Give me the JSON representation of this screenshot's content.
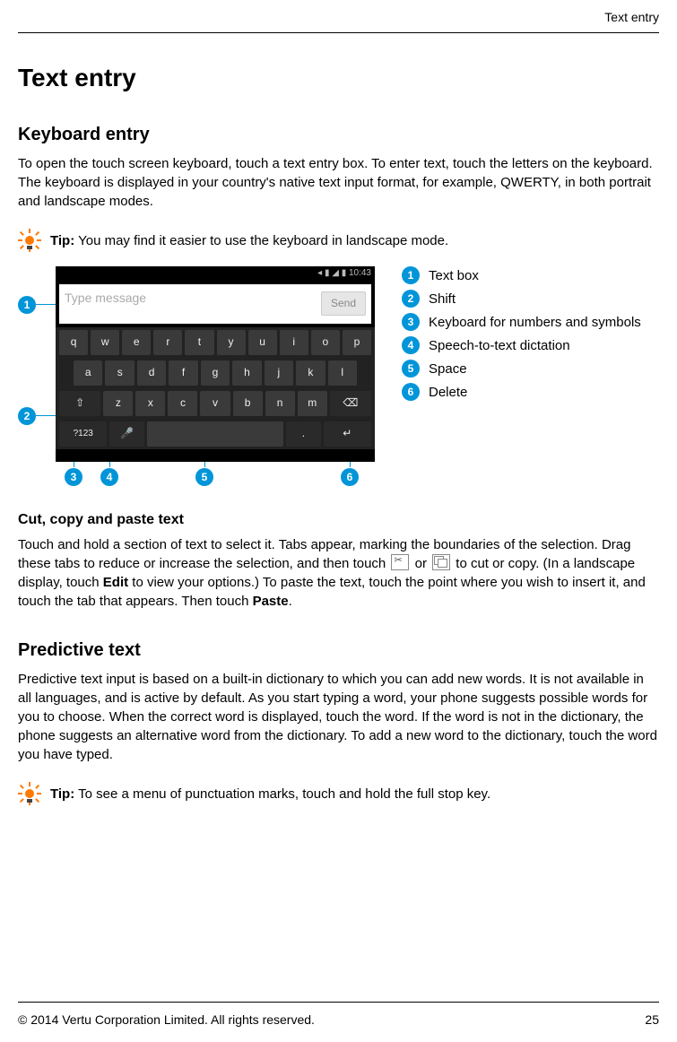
{
  "header": {
    "running_title": "Text entry"
  },
  "title": "Text entry",
  "section1": {
    "heading": "Keyboard entry",
    "body": "To open the touch screen keyboard, touch a text entry box. To enter text, touch the letters on the keyboard. The keyboard is displayed in your country's native text input format, for example, QWERTY, in both portrait and landscape modes."
  },
  "tip1": {
    "label": "Tip:",
    "text": " You may find it easier to use the keyboard in landscape mode."
  },
  "phone": {
    "status_time": "◂ ▮ ◢ ▮ 10:43",
    "placeholder": "Type message",
    "send": "Send",
    "row1": [
      "q",
      "w",
      "e",
      "r",
      "t",
      "y",
      "u",
      "i",
      "o",
      "p"
    ],
    "row2": [
      "a",
      "s",
      "d",
      "f",
      "g",
      "h",
      "j",
      "k",
      "l"
    ],
    "row3_shift": "⇧",
    "row3": [
      "z",
      "x",
      "c",
      "v",
      "b",
      "n",
      "m"
    ],
    "row3_del": "⌫",
    "row4_sym": "?123",
    "row4_mic": "🎤",
    "row4_space": " ",
    "row4_dot": ".",
    "row4_enter": "↵"
  },
  "legend": [
    {
      "n": "1",
      "label": "Text box"
    },
    {
      "n": "2",
      "label": "Shift"
    },
    {
      "n": "3",
      "label": "Keyboard for numbers and symbols"
    },
    {
      "n": "4",
      "label": "Speech-to-text dictation"
    },
    {
      "n": "5",
      "label": "Space"
    },
    {
      "n": "6",
      "label": "Delete"
    }
  ],
  "section2": {
    "heading": "Cut, copy and paste text",
    "body_a": "Touch and hold a section of text to select it. Tabs appear, marking the boundaries of the selection. Drag these tabs to reduce or increase the selection, and then touch ",
    "or": " or ",
    "body_b": " to cut or copy. (In a landscape display, touch ",
    "edit": "Edit",
    "body_c": " to view your options.) To paste the text, touch the point where you wish to insert it, and touch the tab that appears. Then touch ",
    "paste": "Paste",
    "body_d": "."
  },
  "section3": {
    "heading": "Predictive text",
    "body": "Predictive text input is based on a built-in dictionary to which you can add new words. It is not available in all languages, and is active by default. As you start typing a word, your phone suggests possible words for you to choose. When the correct word is displayed, touch the word. If the word is not in the dictionary, the phone suggests an alternative word from the dictionary. To add a new word to the dictionary, touch the word you have typed."
  },
  "tip2": {
    "label": "Tip:",
    "text": " To see a menu of punctuation marks, touch and hold the full stop key."
  },
  "footer": {
    "copyright": "© 2014 Vertu Corporation Limited. All rights reserved.",
    "page": "25"
  }
}
